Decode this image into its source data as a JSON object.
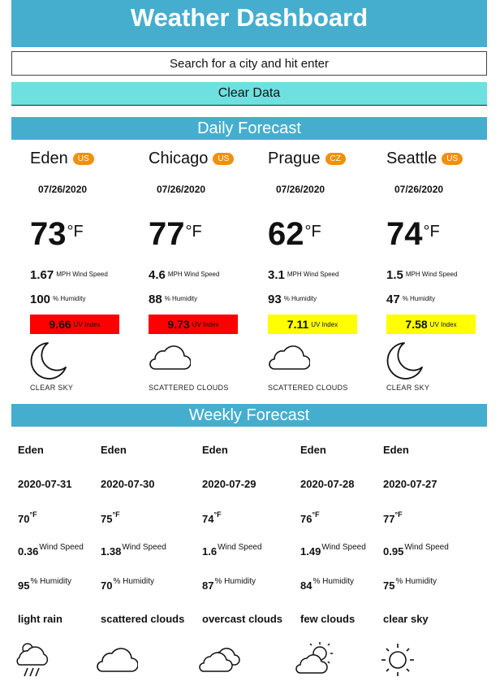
{
  "header": {
    "title": "Weather Dashboard"
  },
  "search": {
    "placeholder": "Search for a city and hit enter"
  },
  "clear_button": {
    "label": "Clear Data"
  },
  "daily": {
    "title": "Daily Forecast",
    "temp_unit": "°F",
    "wind_label": "MPH Wind Speed",
    "humidity_label": "% Humidity",
    "uv_label": "UV Index",
    "cards": [
      {
        "city": "Eden",
        "country": "US",
        "date": "07/26/2020",
        "temp": "73",
        "wind": "1.67",
        "humidity": "100",
        "uv": "9.66",
        "uv_color": "#ff0000",
        "condition": "CLEAR SKY",
        "icon": "moon-icon"
      },
      {
        "city": "Chicago",
        "country": "US",
        "date": "07/26/2020",
        "temp": "77",
        "wind": "4.6",
        "humidity": "88",
        "uv": "9.73",
        "uv_color": "#ff0000",
        "condition": "SCATTERED CLOUDS",
        "icon": "cloud-icon"
      },
      {
        "city": "Prague",
        "country": "CZ",
        "date": "07/26/2020",
        "temp": "62",
        "wind": "3.1",
        "humidity": "93",
        "uv": "7.11",
        "uv_color": "#ffff00",
        "condition": "SCATTERED CLOUDS",
        "icon": "cloud-icon"
      },
      {
        "city": "Seattle",
        "country": "US",
        "date": "07/26/2020",
        "temp": "74",
        "wind": "1.5",
        "humidity": "47",
        "uv": "7.58",
        "uv_color": "#ffff00",
        "condition": "CLEAR SKY",
        "icon": "moon-icon"
      }
    ]
  },
  "weekly": {
    "title": "Weekly Forecast",
    "temp_unit": "°F",
    "wind_label": "Wind Speed",
    "humidity_label": "% Humidity",
    "days": [
      {
        "city": "Eden",
        "date": "2020-07-31",
        "temp": "70",
        "wind": "0.36",
        "humidity": "95",
        "description": "light rain",
        "icon": "rain-cloud-icon"
      },
      {
        "city": "Eden",
        "date": "2020-07-30",
        "temp": "75",
        "wind": "1.38",
        "humidity": "70",
        "description": "scattered clouds",
        "icon": "cloud-icon"
      },
      {
        "city": "Eden",
        "date": "2020-07-29",
        "temp": "74",
        "wind": "1.6",
        "humidity": "87",
        "description": "overcast clouds",
        "icon": "double-cloud-icon"
      },
      {
        "city": "Eden",
        "date": "2020-07-28",
        "temp": "76",
        "wind": "1.49",
        "humidity": "84",
        "description": "few clouds",
        "icon": "sun-cloud-icon"
      },
      {
        "city": "Eden",
        "date": "2020-07-27",
        "temp": "77",
        "wind": "0.95",
        "humidity": "75",
        "description": "clear sky",
        "icon": "sun-icon"
      }
    ]
  }
}
